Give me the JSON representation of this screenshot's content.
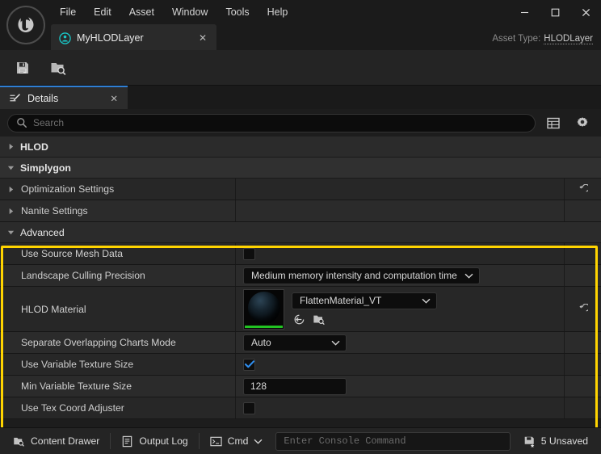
{
  "window": {
    "logo_name": "unreal-engine-logo",
    "menus": [
      "File",
      "Edit",
      "Asset",
      "Window",
      "Tools",
      "Help"
    ],
    "minimize_label": "—",
    "maximize_label": "□",
    "close_label": "×",
    "asset_tab": {
      "label": "MyHLODLayer",
      "close_label": "✕"
    },
    "asset_type": {
      "prefix": "Asset Type:",
      "value": "HLODLayer"
    }
  },
  "toolbar": {
    "save_label": "Save",
    "browse_label": "Browse"
  },
  "details_panel": {
    "tab_label": "Details",
    "tab_close_label": "✕",
    "search": {
      "placeholder": "Search",
      "value": ""
    },
    "grid_view_label": "Column View",
    "settings_label": "View Options"
  },
  "properties": {
    "categories": [
      {
        "label": "HLOD",
        "expanded": false
      },
      {
        "label": "Simplygon",
        "expanded": true
      }
    ],
    "simplygon_rows": [
      {
        "label": "Optimization Settings",
        "type": "expander",
        "reset": true
      },
      {
        "label": "Nanite Settings",
        "type": "expander",
        "reset": false
      }
    ],
    "advanced": {
      "label": "Advanced",
      "expanded": true,
      "rows": [
        {
          "label": "Use Source Mesh Data",
          "type": "checkbox",
          "checked": false,
          "reset": false
        },
        {
          "label": "Landscape Culling Precision",
          "type": "combo",
          "value": "Medium memory intensity and computation time",
          "reset": false
        },
        {
          "label": "HLOD Material",
          "type": "asset",
          "value": "FlattenMaterial_VT",
          "reset": true,
          "thumbnail_name": "material-sphere-thumbnail",
          "use_selected_label": "Use Selected Asset",
          "browse_label": "Browse to Asset"
        },
        {
          "label": "Separate Overlapping Charts Mode",
          "type": "combo",
          "value": "Auto",
          "reset": false
        },
        {
          "label": "Use Variable Texture Size",
          "type": "checkbox",
          "checked": true,
          "reset": false
        },
        {
          "label": "Min Variable Texture Size",
          "type": "number",
          "value": "128",
          "reset": false
        },
        {
          "label": "Use Tex Coord Adjuster",
          "type": "checkbox",
          "checked": false,
          "reset": false
        }
      ]
    }
  },
  "status_bar": {
    "content_drawer": "Content Drawer",
    "output_log": "Output Log",
    "cmd": "Cmd",
    "console_placeholder": "Enter Console Command",
    "unsaved": "5 Unsaved"
  },
  "colors": {
    "highlight": "#ffd400",
    "accent_blue": "#2f7fd4",
    "checkbox_check": "#2f8eef",
    "thumb_green": "#22c322"
  }
}
